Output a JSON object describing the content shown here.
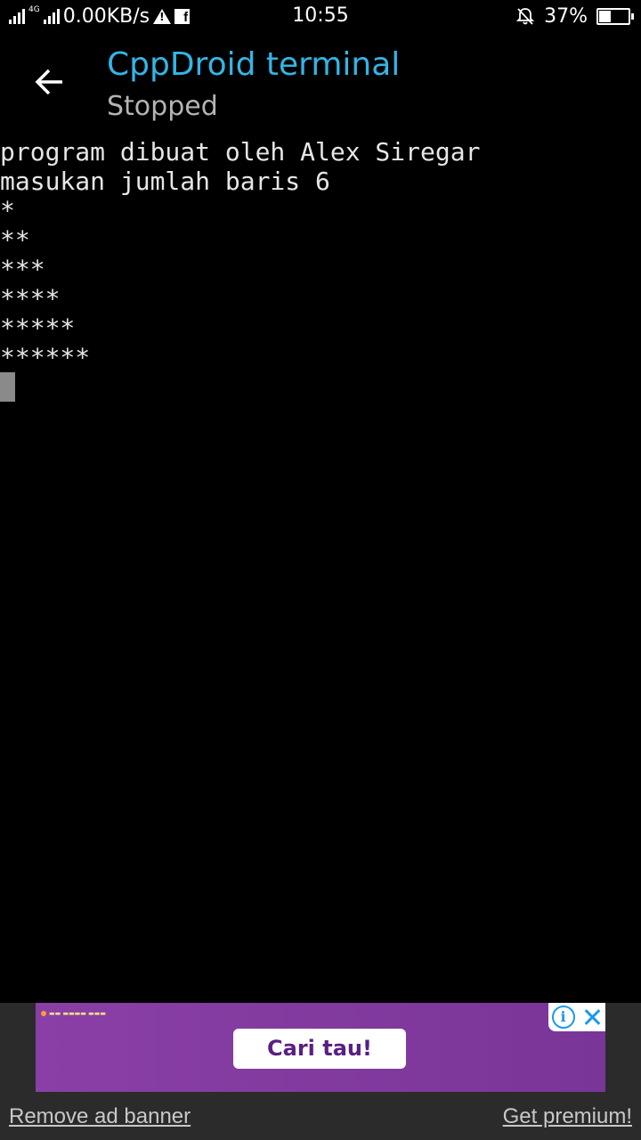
{
  "status_bar": {
    "network_type": "4G",
    "speed": "0.00KB/s",
    "time": "10:55",
    "battery_percent": "37%",
    "battery_level": 0.37,
    "icons": [
      "signal-icon",
      "signal-4g-icon",
      "warning-icon",
      "facebook-icon",
      "mute-bell-icon",
      "battery-icon"
    ]
  },
  "header": {
    "title": "CppDroid terminal",
    "subtitle": "Stopped",
    "back_icon": "arrow-left-icon"
  },
  "terminal": {
    "lines": [
      "program dibuat oleh Alex Siregar",
      "masukan jumlah baris 6",
      "*",
      "**",
      "***",
      "****",
      "*****",
      "******"
    ]
  },
  "ad": {
    "cta_label": "Cari tau!",
    "remove_label": "Remove ad banner",
    "premium_label": "Get premium!"
  },
  "colors": {
    "title": "#33b5e5",
    "subtitle": "#b4b4b4",
    "terminal_bg": "#000000",
    "terminal_text": "#e6e6e6",
    "ad_bg": "#8a3fa6"
  }
}
